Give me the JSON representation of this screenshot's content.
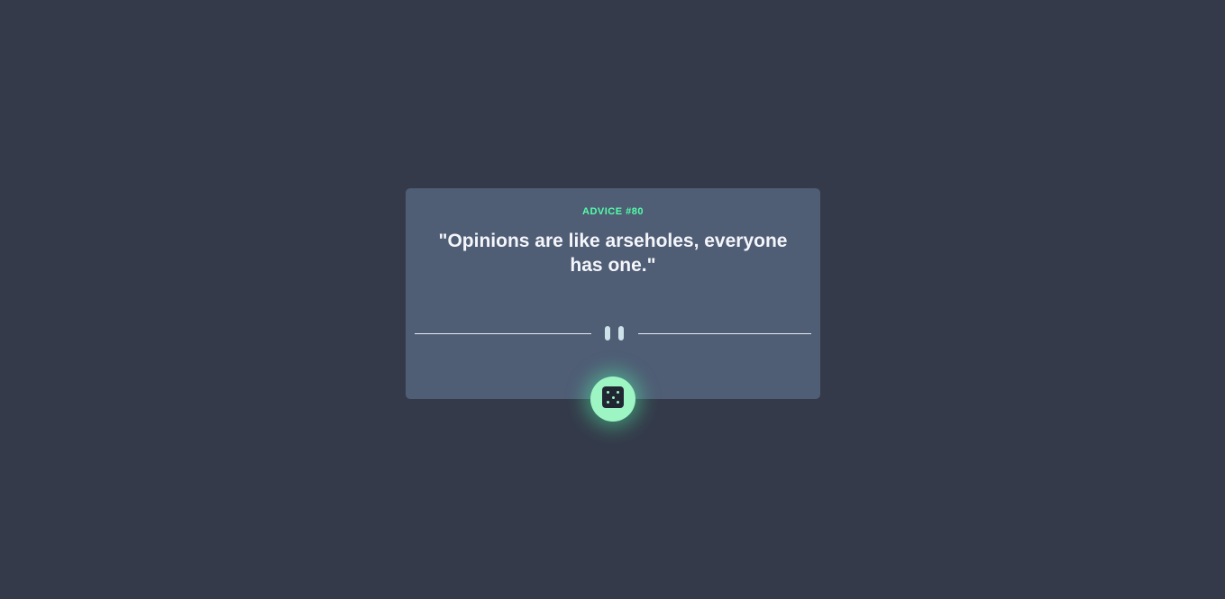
{
  "advice": {
    "id_label": "ADVICE #80",
    "text": "\"Opinions are like arseholes, everyone has one.\""
  },
  "icons": {
    "divider": "pause-icon",
    "button": "dice-icon"
  },
  "colors": {
    "background": "#343a4a",
    "card": "#4f5d75",
    "accent": "#52ffa8",
    "text": "#f4f6fb"
  }
}
